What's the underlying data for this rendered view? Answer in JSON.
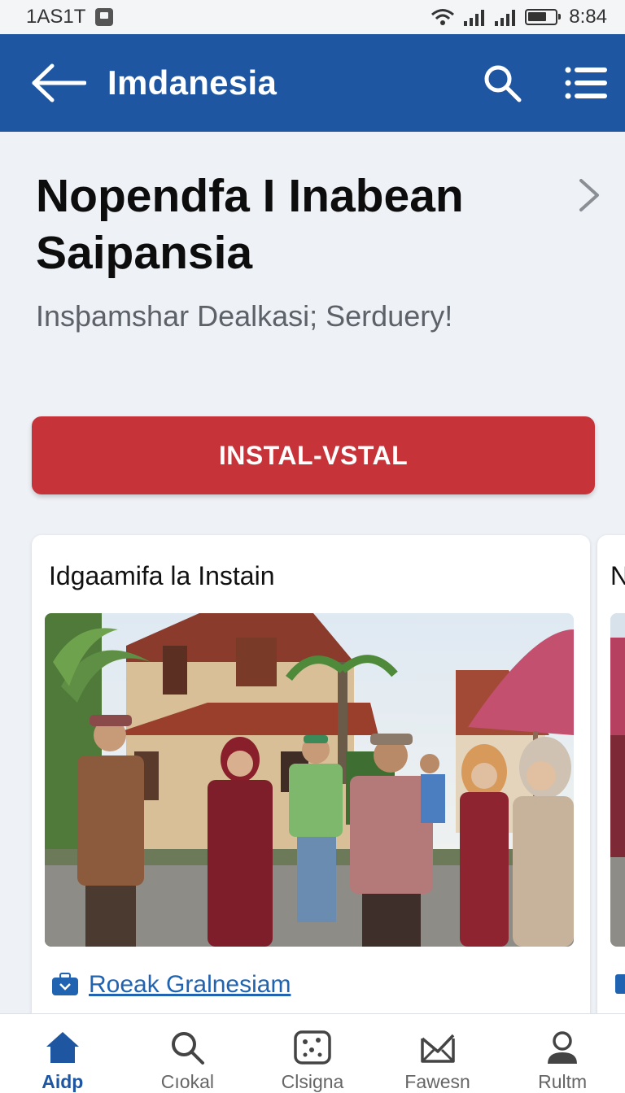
{
  "status_bar": {
    "carrier": "1AS1T",
    "time": "8:84"
  },
  "app_bar": {
    "title": "Imdanesia",
    "icons": [
      "back-arrow-icon",
      "search-icon",
      "menu-icon"
    ]
  },
  "hero": {
    "title": "Nopendfa I Inabean Saipansia",
    "subtitle": "Insþamshar Dealkasi; Serduery!"
  },
  "primary_button": {
    "label": "INSTAL-VSTAL"
  },
  "cards": [
    {
      "title": "Idgaamifa la Instain",
      "link": "Roeak Gralnesiam"
    },
    {
      "title": "N"
    }
  ],
  "bottom_nav": {
    "items": [
      {
        "label": "Aidp",
        "icon": "home-icon",
        "active": true
      },
      {
        "label": "Cıokal",
        "icon": "search-icon",
        "active": false
      },
      {
        "label": "Clsigna",
        "icon": "photo-icon",
        "active": false
      },
      {
        "label": "Fawesn",
        "icon": "mail-icon",
        "active": false
      },
      {
        "label": "Rultm",
        "icon": "profile-icon",
        "active": false
      }
    ]
  },
  "colors": {
    "app_bar": "#1f56a2",
    "primary_button": "#c6343a",
    "link": "#1f63b1",
    "background": "#eef1f6"
  }
}
